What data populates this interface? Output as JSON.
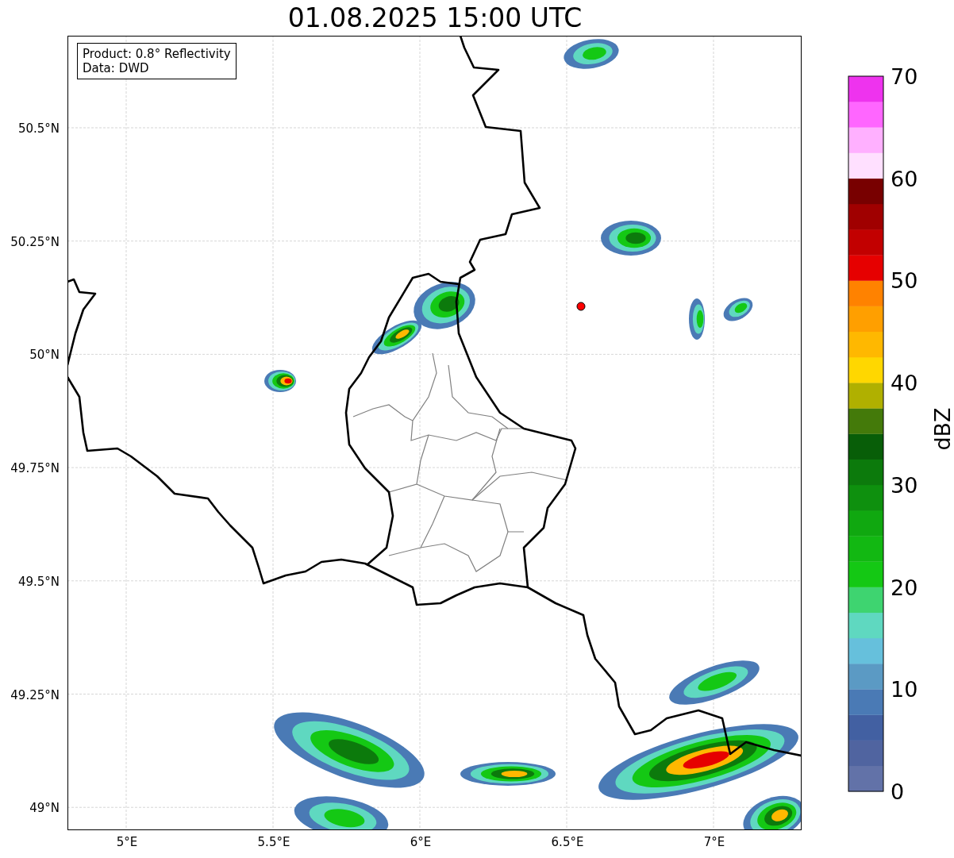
{
  "title": "01.08.2025 15:00 UTC",
  "legend": [
    "Product: 0.8° Reflectivity",
    "Data: DWD"
  ],
  "x_ticks": [
    "5°E",
    "5.5°E",
    "6°E",
    "6.5°E",
    "7°E"
  ],
  "y_ticks": [
    "50.5°N",
    "50.25°N",
    "50°N",
    "49.75°N",
    "49.5°N",
    "49.25°N",
    "49°N"
  ],
  "colorbar": {
    "label": "dBZ",
    "ticks": [
      "70",
      "60",
      "50",
      "40",
      "30",
      "20",
      "10",
      "0"
    ],
    "bands": [
      {
        "color": "#6272a8"
      },
      {
        "color": "#5064a0"
      },
      {
        "color": "#4260a2"
      },
      {
        "color": "#4a7ab5"
      },
      {
        "color": "#5b9ac4"
      },
      {
        "color": "#66c0dc"
      },
      {
        "color": "#5fd8c0"
      },
      {
        "color": "#3ed470"
      },
      {
        "color": "#14c814"
      },
      {
        "color": "#12b812"
      },
      {
        "color": "#10a810"
      },
      {
        "color": "#0e900e"
      },
      {
        "color": "#0c7a0c"
      },
      {
        "color": "#085e08"
      },
      {
        "color": "#447a0a"
      },
      {
        "color": "#b0b000"
      },
      {
        "color": "#ffd700"
      },
      {
        "color": "#ffb800"
      },
      {
        "color": "#ff9f00"
      },
      {
        "color": "#ff8200"
      },
      {
        "color": "#e60000"
      },
      {
        "color": "#c20000"
      },
      {
        "color": "#a00000"
      },
      {
        "color": "#780000"
      },
      {
        "color": "#ffe0ff"
      },
      {
        "color": "#ffb0ff"
      },
      {
        "color": "#ff66ff"
      },
      {
        "color": "#ee33ee"
      }
    ]
  }
}
